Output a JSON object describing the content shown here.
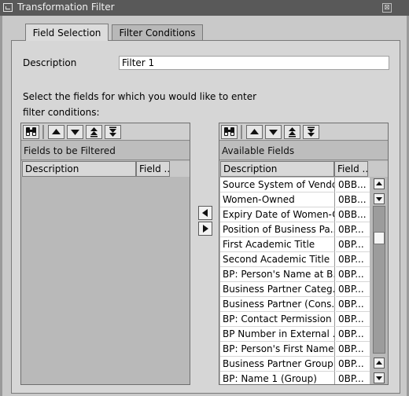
{
  "window": {
    "title": "Transformation Filter",
    "close_glyph": "⊠"
  },
  "tabs": [
    {
      "label": "Field Selection",
      "active": true
    },
    {
      "label": "Filter Conditions",
      "active": false
    }
  ],
  "description": {
    "label": "Description",
    "value": "Filter 1"
  },
  "instructions": {
    "line1": "Select the fields for which you would like to enter",
    "line2": "filter conditions:"
  },
  "left_table": {
    "title": "Fields to be Filtered",
    "columns": [
      "Description",
      "Field ..."
    ],
    "rows": []
  },
  "right_table": {
    "title": "Available Fields",
    "columns": [
      "Description",
      "Field ..."
    ],
    "rows": [
      {
        "desc": "Source System of Vendor",
        "field": "0BB..."
      },
      {
        "desc": "Women-Owned",
        "field": "0BB..."
      },
      {
        "desc": "Expiry Date of Women-O...",
        "field": "0BB..."
      },
      {
        "desc": "Position of Business Pa...",
        "field": "0BP..."
      },
      {
        "desc": "First Academic Title",
        "field": "0BP..."
      },
      {
        "desc": "Second Academic Title",
        "field": "0BP..."
      },
      {
        "desc": "BP: Person's Name at B...",
        "field": "0BP..."
      },
      {
        "desc": "Business Partner Categ...",
        "field": "0BP..."
      },
      {
        "desc": "Business Partner (Cons...",
        "field": "0BP..."
      },
      {
        "desc": "BP: Contact Permission",
        "field": "0BP..."
      },
      {
        "desc": "BP Number in External ...",
        "field": "0BP..."
      },
      {
        "desc": "BP: Person's First Name",
        "field": "0BP..."
      },
      {
        "desc": "Business Partner Group...",
        "field": "0BP..."
      },
      {
        "desc": "BP: Name 1 (Group)",
        "field": "0BP..."
      }
    ]
  },
  "icons": {
    "find": "binoculars-icon",
    "up": "arrow-up-icon",
    "down": "arrow-down-icon",
    "top": "move-top-icon",
    "bottom": "move-bottom-icon",
    "move_left": "arrow-left-icon",
    "move_right": "arrow-right-icon"
  },
  "colors": {
    "titlebar": "#595959",
    "panel": "#d6d6d6",
    "list_bg": "#ffffff"
  }
}
